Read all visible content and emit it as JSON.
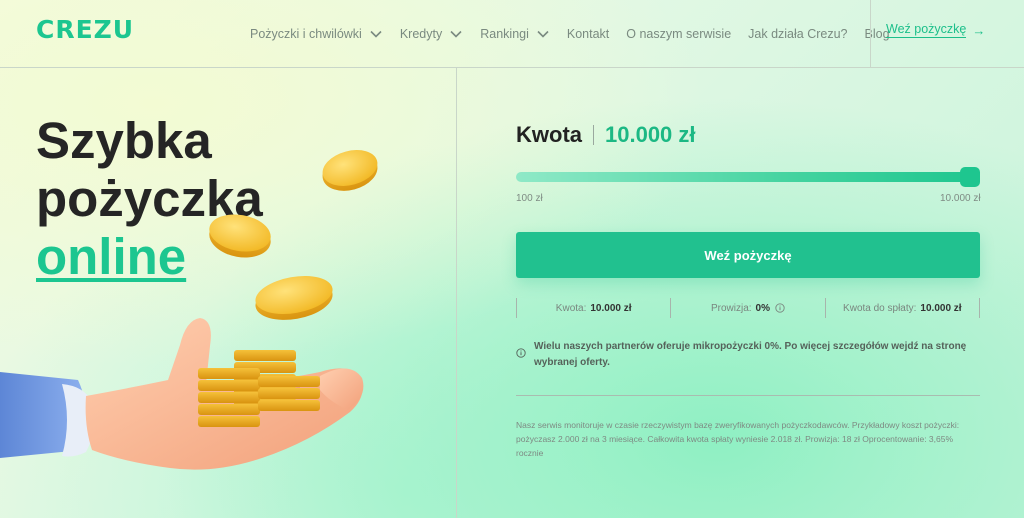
{
  "header": {
    "logo": "CREZU",
    "nav": [
      {
        "label": "Pożyczki i chwilówki",
        "has_dropdown": true
      },
      {
        "label": "Kredyty",
        "has_dropdown": true
      },
      {
        "label": "Rankingi",
        "has_dropdown": true
      },
      {
        "label": "Kontakt",
        "has_dropdown": false
      },
      {
        "label": "O naszym serwisie",
        "has_dropdown": false
      },
      {
        "label": "Jak działa Crezu?",
        "has_dropdown": false
      },
      {
        "label": "Blog",
        "has_dropdown": false
      }
    ],
    "cta_label": "Weź pożyczkę",
    "cta_arrow": "→"
  },
  "hero": {
    "line1": "Szybka",
    "line2": "pożyczka",
    "line3": "online"
  },
  "calculator": {
    "amount_label": "Kwota",
    "amount_value": "10.000 zł",
    "slider_min_label": "100 zł",
    "slider_max_label": "10.000 zł",
    "slider_fraction": 1.0,
    "button_label": "Weź pożyczkę",
    "summary": [
      {
        "label": "Kwota:",
        "value": "10.000 zł",
        "info_icon": false
      },
      {
        "label": "Prowizja:",
        "value": "0%",
        "info_icon": true
      },
      {
        "label": "Kwota do spłaty:",
        "value": "10.000 zł",
        "info_icon": false
      }
    ],
    "notice": "Wielu naszych partnerów oferuje mikropożyczki 0%. Po więcej szczegółów wejdź na stronę wybranej oferty.",
    "footnote": "Nasz serwis monitoruje w czasie rzeczywistym bazę zweryfikowanych pożyczkodawców. Przykładowy koszt pożyczki: pożyczasz 2.000 zł na 3 miesiące. Całkowita kwota spłaty wyniesie 2.018 zł. Prowizja: 18 zł Oprocentowanie: 3,65% rocznie"
  },
  "colors": {
    "accent": "#1cc690",
    "button": "#21c18f",
    "text_dark": "#252525"
  }
}
